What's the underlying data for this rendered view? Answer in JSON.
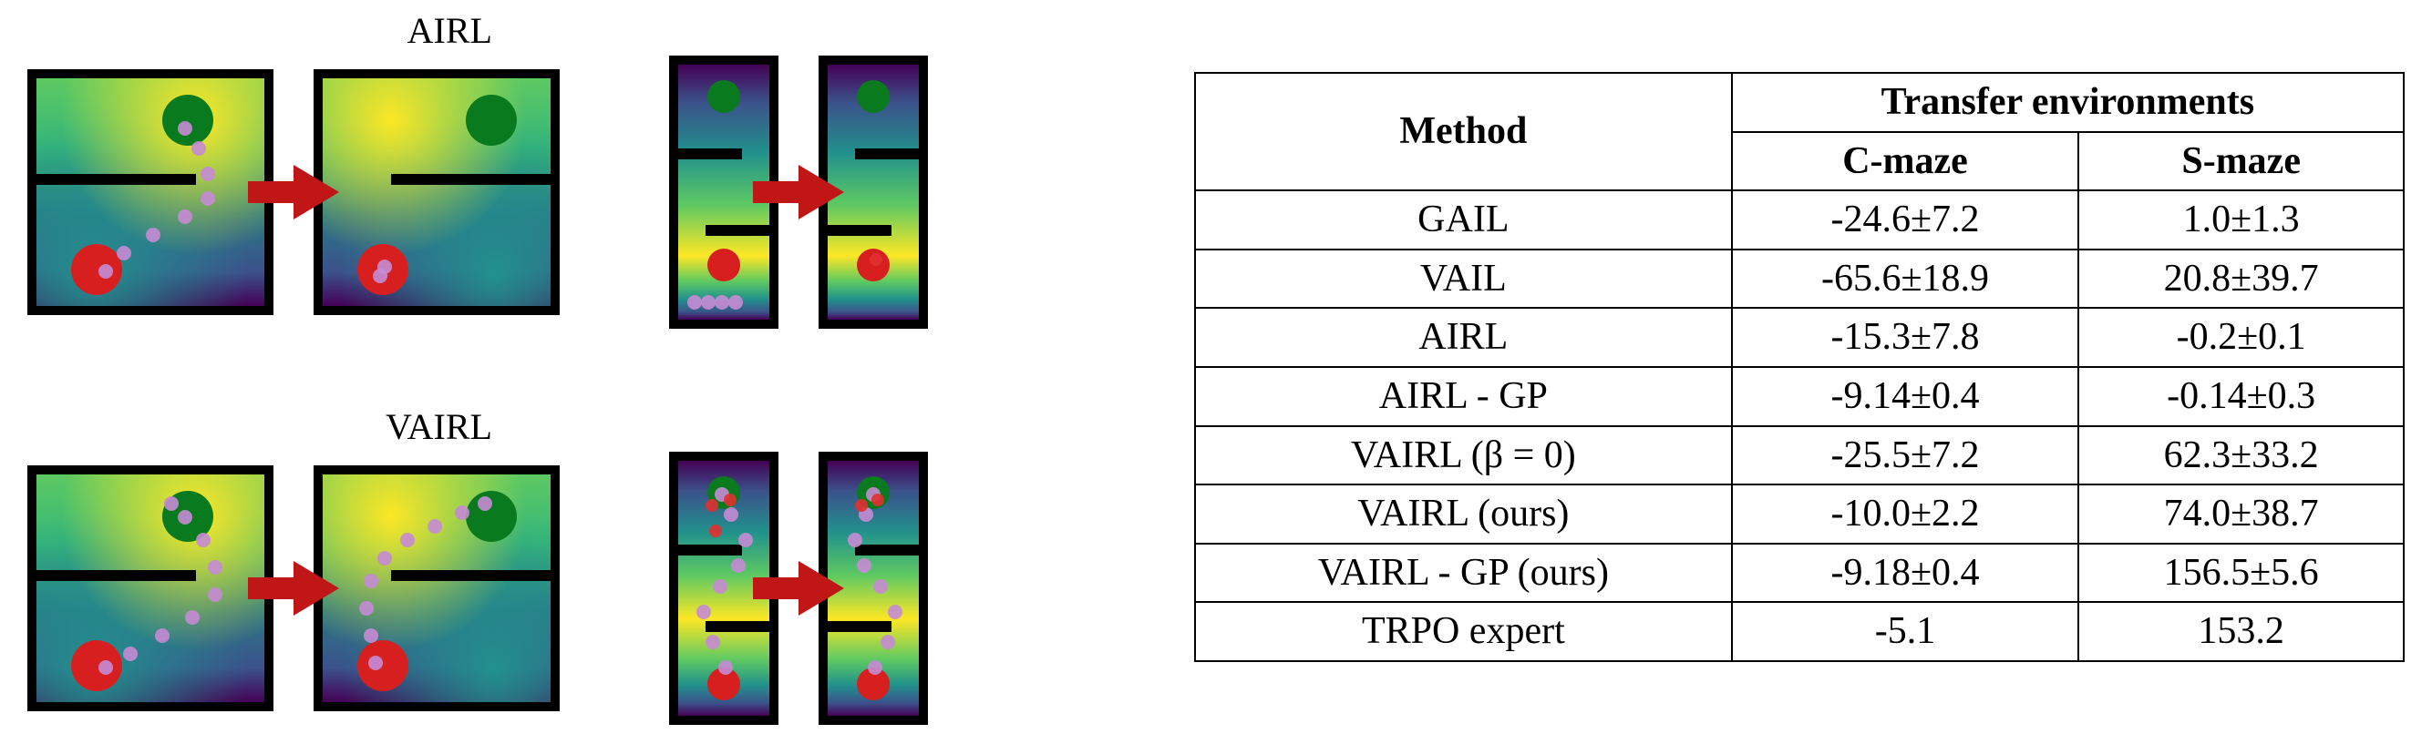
{
  "figure": {
    "labels": {
      "airl": "AIRL",
      "vairl": "VAIRL"
    }
  },
  "table": {
    "header": {
      "method": "Method",
      "group": "Transfer environments",
      "cmaze": "C-maze",
      "smaze": "S-maze"
    },
    "rows": [
      {
        "method": "GAIL",
        "cmaze": "-24.6±7.2",
        "smaze": "1.0±1.3",
        "bold_c": false,
        "bold_s": false
      },
      {
        "method": "VAIL",
        "cmaze": "-65.6±18.9",
        "smaze": "20.8±39.7",
        "bold_c": false,
        "bold_s": false
      },
      {
        "method": "AIRL",
        "cmaze": "-15.3±7.8",
        "smaze": "-0.2±0.1",
        "bold_c": false,
        "bold_s": false
      },
      {
        "method": "AIRL - GP",
        "cmaze": "-9.14±0.4",
        "smaze": "-0.14±0.3",
        "bold_c": true,
        "bold_s": false
      },
      {
        "method": "VAIRL (β = 0)",
        "cmaze": "-25.5±7.2",
        "smaze": "62.3±33.2",
        "bold_c": false,
        "bold_s": false
      },
      {
        "method": "VAIRL (ours)",
        "cmaze": "-10.0±2.2",
        "smaze": "74.0±38.7",
        "bold_c": false,
        "bold_s": false
      },
      {
        "method": "VAIRL - GP (ours)",
        "cmaze": "-9.18±0.4",
        "smaze": "156.5±5.6",
        "bold_c": false,
        "bold_s": true
      }
    ],
    "footer": {
      "method": "TRPO expert",
      "cmaze": "-5.1",
      "smaze": "153.2"
    }
  },
  "chart_data": {
    "type": "table",
    "title": "Transfer environments",
    "columns": [
      "Method",
      "C-maze",
      "S-maze"
    ],
    "rows": [
      [
        "GAIL",
        -24.6,
        1.0
      ],
      [
        "VAIL",
        -65.6,
        20.8
      ],
      [
        "AIRL",
        -15.3,
        -0.2
      ],
      [
        "AIRL - GP",
        -9.14,
        -0.14
      ],
      [
        "VAIRL (β = 0)",
        -25.5,
        62.3
      ],
      [
        "VAIRL (ours)",
        -10.0,
        74.0
      ],
      [
        "VAIRL - GP (ours)",
        -9.18,
        156.5
      ],
      [
        "TRPO expert",
        -5.1,
        153.2
      ]
    ],
    "std": {
      "GAIL": [
        7.2,
        1.3
      ],
      "VAIL": [
        18.9,
        39.7
      ],
      "AIRL": [
        7.8,
        0.1
      ],
      "AIRL - GP": [
        0.4,
        0.3
      ],
      "VAIRL (β = 0)": [
        7.2,
        33.2
      ],
      "VAIRL (ours)": [
        2.2,
        38.7
      ],
      "VAIRL - GP (ours)": [
        0.4,
        5.6
      ]
    },
    "bold_best": {
      "C-maze": "AIRL - GP",
      "S-maze": "VAIRL - GP (ours)"
    }
  }
}
